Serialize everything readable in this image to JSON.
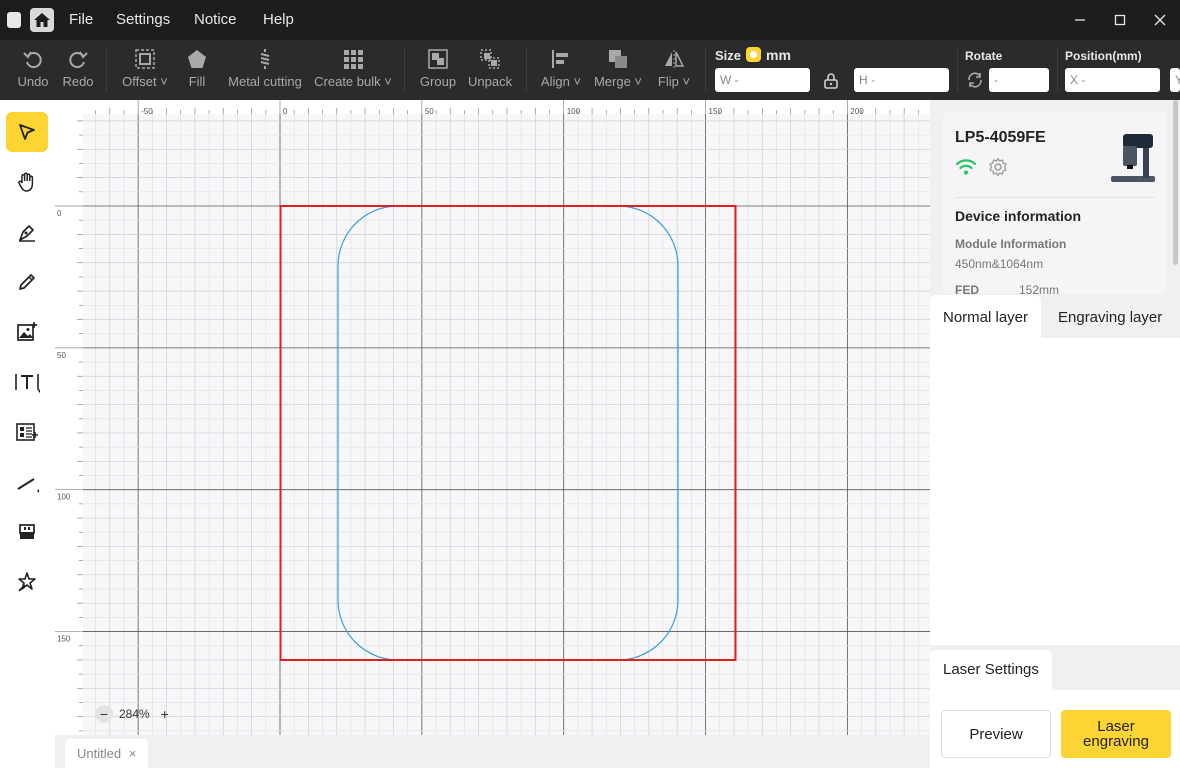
{
  "menu": {
    "file": "File",
    "settings": "Settings",
    "notice": "Notice",
    "help": "Help"
  },
  "toolbar": {
    "undo": "Undo",
    "redo": "Redo",
    "offset": "Offset",
    "fill": "Fill",
    "metal_cutting": "Metal cutting",
    "create_bulk": "Create bulk",
    "group": "Group",
    "unpack": "Unpack",
    "align": "Align",
    "merge": "Merge",
    "flip": "Flip",
    "size_label": "Size",
    "unit": "mm",
    "w_field": "W -",
    "h_field": "H -",
    "rotate_label": "Rotate",
    "rotate_field": "-",
    "position_label": "Position(mm)",
    "x_field": "X -",
    "y_field": "Y"
  },
  "ruler": {
    "x_ticks": [
      "-50",
      "0",
      "50",
      "100",
      "150",
      "200"
    ],
    "y_ticks": [
      "0",
      "50",
      "100",
      "150"
    ]
  },
  "canvas": {
    "zoom_level": "284%",
    "selection_color": "#e02020",
    "shape_color": "#3a9be0"
  },
  "file_tab": {
    "label": "Untitled",
    "close": "×"
  },
  "device": {
    "name": "LP5-4059FE",
    "info_title": "Device information",
    "module_title": "Module Information",
    "module_value": "450nm&1064nm",
    "fed_label": "FED",
    "fed_value": "152mm",
    "wifi_color": "#22c55e"
  },
  "layers": {
    "normal": "Normal layer",
    "engraving": "Engraving layer"
  },
  "laser": {
    "settings_tab": "Laser Settings",
    "preview": "Preview",
    "engrave": "Laser engraving"
  },
  "colors": {
    "accent": "#fcd535"
  }
}
